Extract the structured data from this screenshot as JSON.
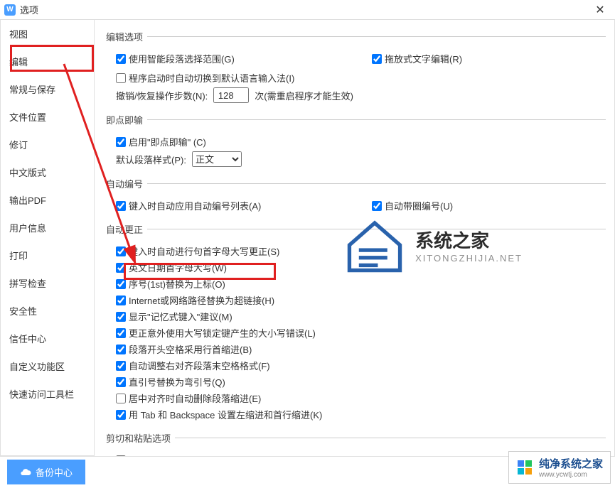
{
  "window": {
    "title": "选项"
  },
  "sidebar": {
    "items": [
      {
        "label": "视图"
      },
      {
        "label": "编辑"
      },
      {
        "label": "常规与保存"
      },
      {
        "label": "文件位置"
      },
      {
        "label": "修订"
      },
      {
        "label": "中文版式"
      },
      {
        "label": "输出PDF"
      },
      {
        "label": "用户信息"
      },
      {
        "label": "打印"
      },
      {
        "label": "拼写检查"
      },
      {
        "label": "安全性"
      },
      {
        "label": "信任中心"
      },
      {
        "label": "自定义功能区"
      },
      {
        "label": "快速访问工具栏"
      }
    ],
    "selected_index": 1
  },
  "groups": {
    "edit": {
      "legend": "编辑选项",
      "smart_select": "使用智能段落选择范围(G)",
      "drag_edit": "拖放式文字编辑(R)",
      "auto_ime": "程序启动时自动切换到默认语言输入法(I)",
      "undo_label": "撤销/恢复操作步数(N):",
      "undo_value": 128,
      "undo_suffix": "次(需重启程序才能生效)"
    },
    "click_type": {
      "legend": "即点即输",
      "enable": "启用\"即点即输\" (C)",
      "default_style_label": "默认段落样式(P):",
      "default_style_value": "正文"
    },
    "auto_number": {
      "legend": "自动编号",
      "apply_list": "键入时自动应用自动编号列表(A)",
      "auto_circle": "自动带圈编号(U)"
    },
    "auto_correct": {
      "legend": "自动更正",
      "items": [
        {
          "label": "键入时自动进行句首字母大写更正(S)",
          "checked": true
        },
        {
          "label": "英文日期首字母大写(W)",
          "checked": true
        },
        {
          "label": "序号(1st)替换为上标(O)",
          "checked": true
        },
        {
          "label": "Internet或网络路径替换为超链接(H)",
          "checked": true
        },
        {
          "label": "显示\"记忆式键入\"建议(M)",
          "checked": true
        },
        {
          "label": "更正意外使用大写锁定键产生的大小写错误(L)",
          "checked": true
        },
        {
          "label": "段落开头空格采用行首缩进(B)",
          "checked": true
        },
        {
          "label": "自动调整右对齐段落末空格格式(F)",
          "checked": true
        },
        {
          "label": "直引号替换为弯引号(Q)",
          "checked": true
        },
        {
          "label": "居中对齐时自动删除段落缩进(E)",
          "checked": false
        },
        {
          "label": "用 Tab 和 Backspace 设置左缩进和首行缩进(K)",
          "checked": true
        }
      ]
    },
    "cut_paste": {
      "legend": "剪切和粘贴选项"
    }
  },
  "footer": {
    "backup": "备份中心"
  },
  "watermark": {
    "brand1": "系统之家",
    "brand1_sub": "XITONGZHIJIA.NET",
    "brand2": "纯净系统之家",
    "brand2_sub": "www.ycwtj.com"
  }
}
